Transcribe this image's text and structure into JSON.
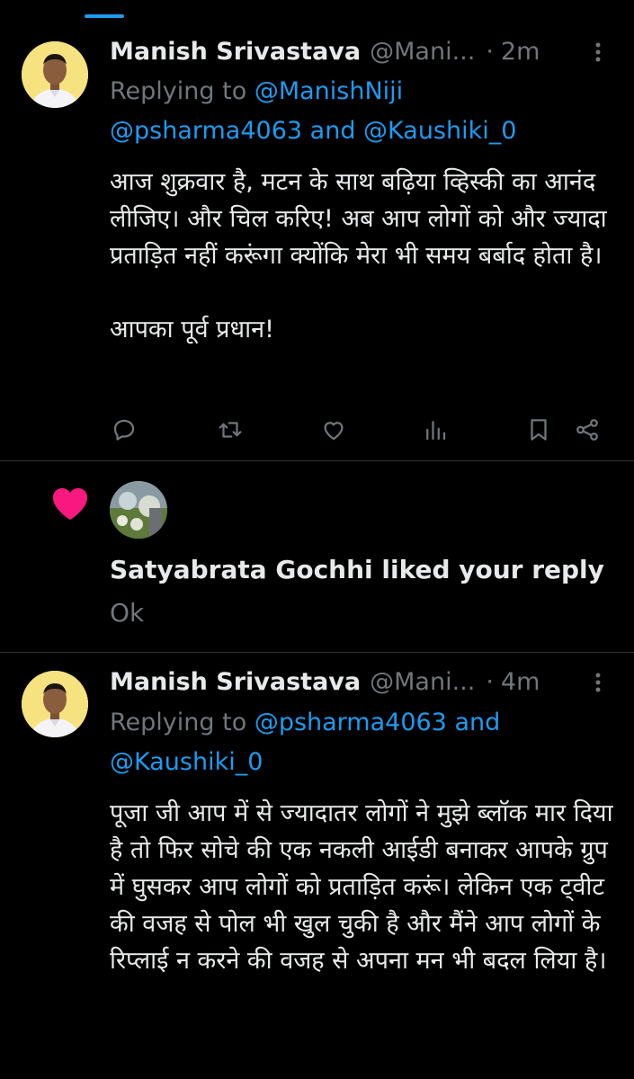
{
  "colors": {
    "background": "#000000",
    "text_primary": "#e7e9ea",
    "text_secondary": "#71767b",
    "accent_blue": "#1d9bf0",
    "like_pink": "#f91880",
    "divider": "#2f3336"
  },
  "tweet1": {
    "author_name": "Manish Srivastava",
    "handle": "@Mani...",
    "separator": "·",
    "time": "2m",
    "replying_prefix": "Replying to",
    "mention_1": "@ManishNiji",
    "mention_2": "@psharma4063",
    "and_word": "and",
    "mention_3": "@Kaushiki_0",
    "body": "आज शुक्रवार है, मटन के साथ बढ़िया व्हिस्की का आनंद लीजिए। और चिल करिए! अब आप लोगों को और ज्यादा प्रताड़ित नहीं करूंगा क्योंकि मेरा भी समय बर्बाद होता है।\n\nआपका पूर्व प्रधान!",
    "actions": [
      "reply-icon",
      "retweet-icon",
      "like-icon",
      "views-icon",
      "bookmark-icon",
      "share-icon"
    ]
  },
  "notification": {
    "icon": "heart-icon",
    "text": "Satyabrata Gochhi liked your reply",
    "snippet": "Ok"
  },
  "tweet2": {
    "author_name": "Manish Srivastava",
    "handle": "@Mani...",
    "separator": "·",
    "time": "4m",
    "replying_prefix": "Replying to",
    "mention_1": "@psharma4063",
    "and_word": "and",
    "mention_2": "@Kaushiki_0",
    "body": "पूजा जी आप में से ज्यादातर लोगों ने मुझे ब्लॉक मार दिया है तो फिर सोचे की एक नकली आईडी बनाकर आपके ग्रुप में घुसकर आप लोगों को प्रताड़ित करूं। लेकिन एक ट्वीट की वजह से पोल भी खुल चुकी है और मैंने आप लोगों के रिप्लाई न करने की वजह से अपना मन भी बदल लिया है।"
  }
}
